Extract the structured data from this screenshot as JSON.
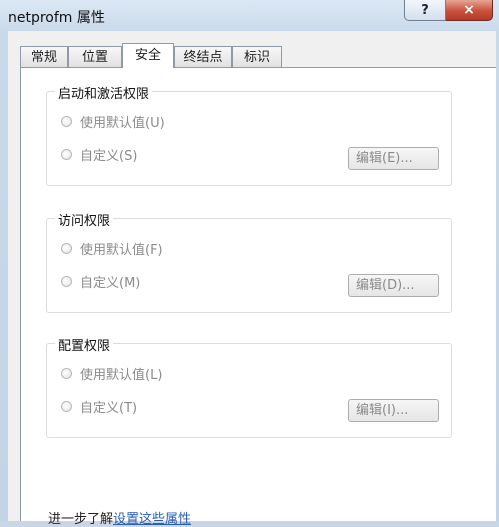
{
  "window": {
    "title": "netprofm 属性",
    "help_label": "?",
    "close_label": "×"
  },
  "tabs": [
    {
      "label": "常规"
    },
    {
      "label": "位置"
    },
    {
      "label": "安全"
    },
    {
      "label": "终结点"
    },
    {
      "label": "标识"
    }
  ],
  "active_tab": "安全",
  "groups": {
    "launch": {
      "title": "启动和激活权限",
      "default_label": "使用默认值(U)",
      "custom_label": "自定义(S)",
      "edit_label": "编辑(E)..."
    },
    "access": {
      "title": "访问权限",
      "default_label": "使用默认值(F)",
      "custom_label": "自定义(M)",
      "edit_label": "编辑(D)..."
    },
    "config": {
      "title": "配置权限",
      "default_label": "使用默认值(L)",
      "custom_label": "自定义(T)",
      "edit_label": "编辑(I)..."
    }
  },
  "footer": {
    "prefix": "进一步了解",
    "link": "设置这些属性"
  }
}
